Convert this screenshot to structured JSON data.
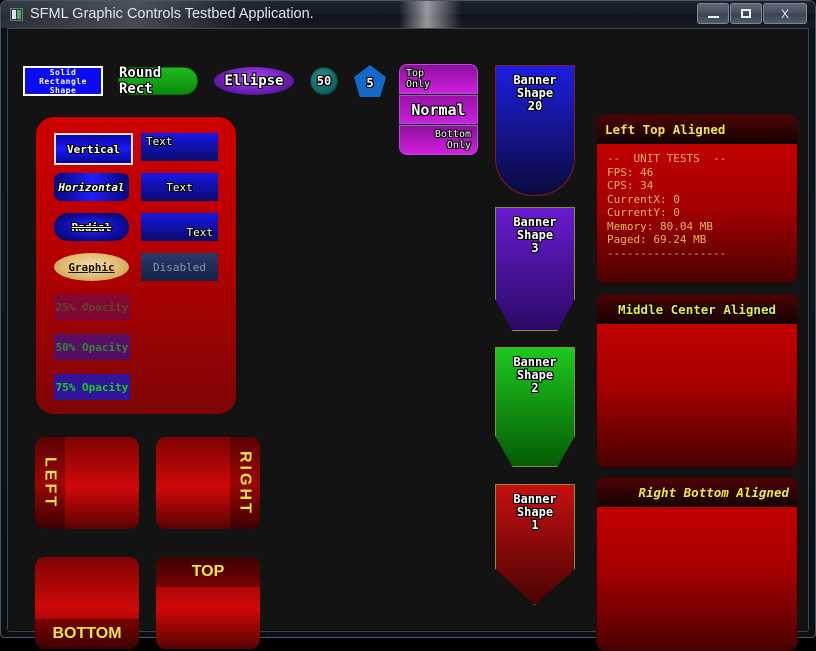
{
  "window": {
    "title": "SFML Graphic Controls Testbed Application.",
    "minimize_label": "Minimize",
    "maximize_label": "Maximize",
    "close_label": "X"
  },
  "shapes": {
    "solid_rect": "Solid\nRectangle\nShape",
    "round_rect": "Round Rect",
    "ellipse": "Ellipse",
    "circle": "50",
    "pentagon": "5"
  },
  "multipanel": {
    "top": "Top\nOnly",
    "middle": "Normal",
    "bottom": "Bottom\nOnly"
  },
  "gradient_buttons": [
    {
      "label": "Vertical"
    },
    {
      "label": "Horizontal"
    },
    {
      "label": "Radial"
    },
    {
      "label": "Graphic"
    }
  ],
  "text_buttons": [
    {
      "label": "Text"
    },
    {
      "label": "Text"
    },
    {
      "label": "Text"
    },
    {
      "label": "Disabled"
    }
  ],
  "opacity_buttons": [
    {
      "label": "25% Opacity"
    },
    {
      "label": "50% Opacity"
    },
    {
      "label": "75% Opacity"
    }
  ],
  "banners": [
    {
      "label": "Banner\nShape\n20"
    },
    {
      "label": "Banner\nShape\n3"
    },
    {
      "label": "Banner\nShape\n2"
    },
    {
      "label": "Banner\nShape\n1"
    }
  ],
  "panels": [
    {
      "title": "Left Top Aligned",
      "body": "--  UNIT TESTS  --\nFPS: 46\nCPS: 34\nCurrentX: 0\nCurrentY: 0\nMemory: 80.04 MB\nPaged: 69.24 MB\n------------------"
    },
    {
      "title": "Middle Center Aligned",
      "body": ""
    },
    {
      "title": "Right Bottom Aligned",
      "body": ""
    }
  ],
  "align_boxes": [
    {
      "label": "LEFT"
    },
    {
      "label": "RIGHT"
    },
    {
      "label": "BOTTOM"
    },
    {
      "label": "TOP"
    }
  ],
  "colors": {
    "desktop": "#000000",
    "client_bg": "#131313",
    "panel_red": "#cf0000",
    "accent_yellow": "#e8e84a",
    "info_text": "#e8b45a",
    "blue": "#1a1aff",
    "green": "#16d016",
    "purple": "#c91fd8"
  }
}
